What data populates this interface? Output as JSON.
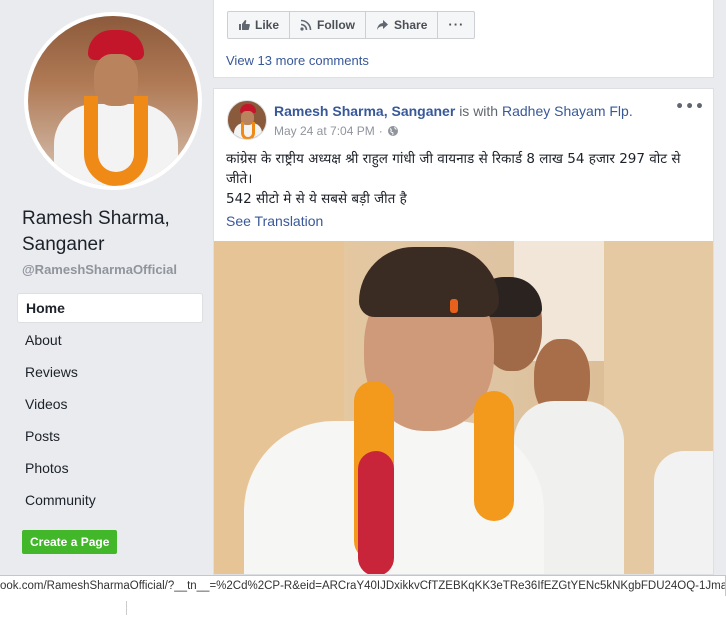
{
  "sidebar": {
    "page_name": "Ramesh Sharma, Sanganer",
    "handle": "@RameshSharmaOfficial",
    "nav": [
      "Home",
      "About",
      "Reviews",
      "Videos",
      "Posts",
      "Photos",
      "Community"
    ],
    "active": "Home",
    "create_page": "Create a Page"
  },
  "prev_post": {
    "actions": {
      "like": "Like",
      "follow": "Follow",
      "share": "Share",
      "more": "···"
    },
    "view_comments": "View 13 more comments"
  },
  "post": {
    "author": "Ramesh Sharma, Sanganer",
    "with_text": "is with",
    "tagged": "Radhey Shayam Flp.",
    "time": "May 24 at 7:04 PM",
    "privacy_icon": "globe-icon",
    "more": "•••",
    "text_line1": "कांग्रेस के राष्ट्रीय अध्यक्ष श्री राहुल गांधी जी वायनाड से रिकार्ड 8 लाख 54 हजार 297 वोट से जीते।",
    "text_line2": "542 सीटो मे से ये सबसे बड़ी जीत है",
    "see_translation": "See Translation"
  },
  "status_url": "ook.com/RameshSharmaOfficial/?__tn__=%2Cd%2CP-R&eid=ARCraY40IJDxikkvCfTZEBKqKK3eTRe36IfEZGtYENc5kNKgbFDU24OQ-1Jmau6",
  "colors": {
    "link": "#385898",
    "green_button": "#42b72a",
    "background": "#e9ebee"
  }
}
